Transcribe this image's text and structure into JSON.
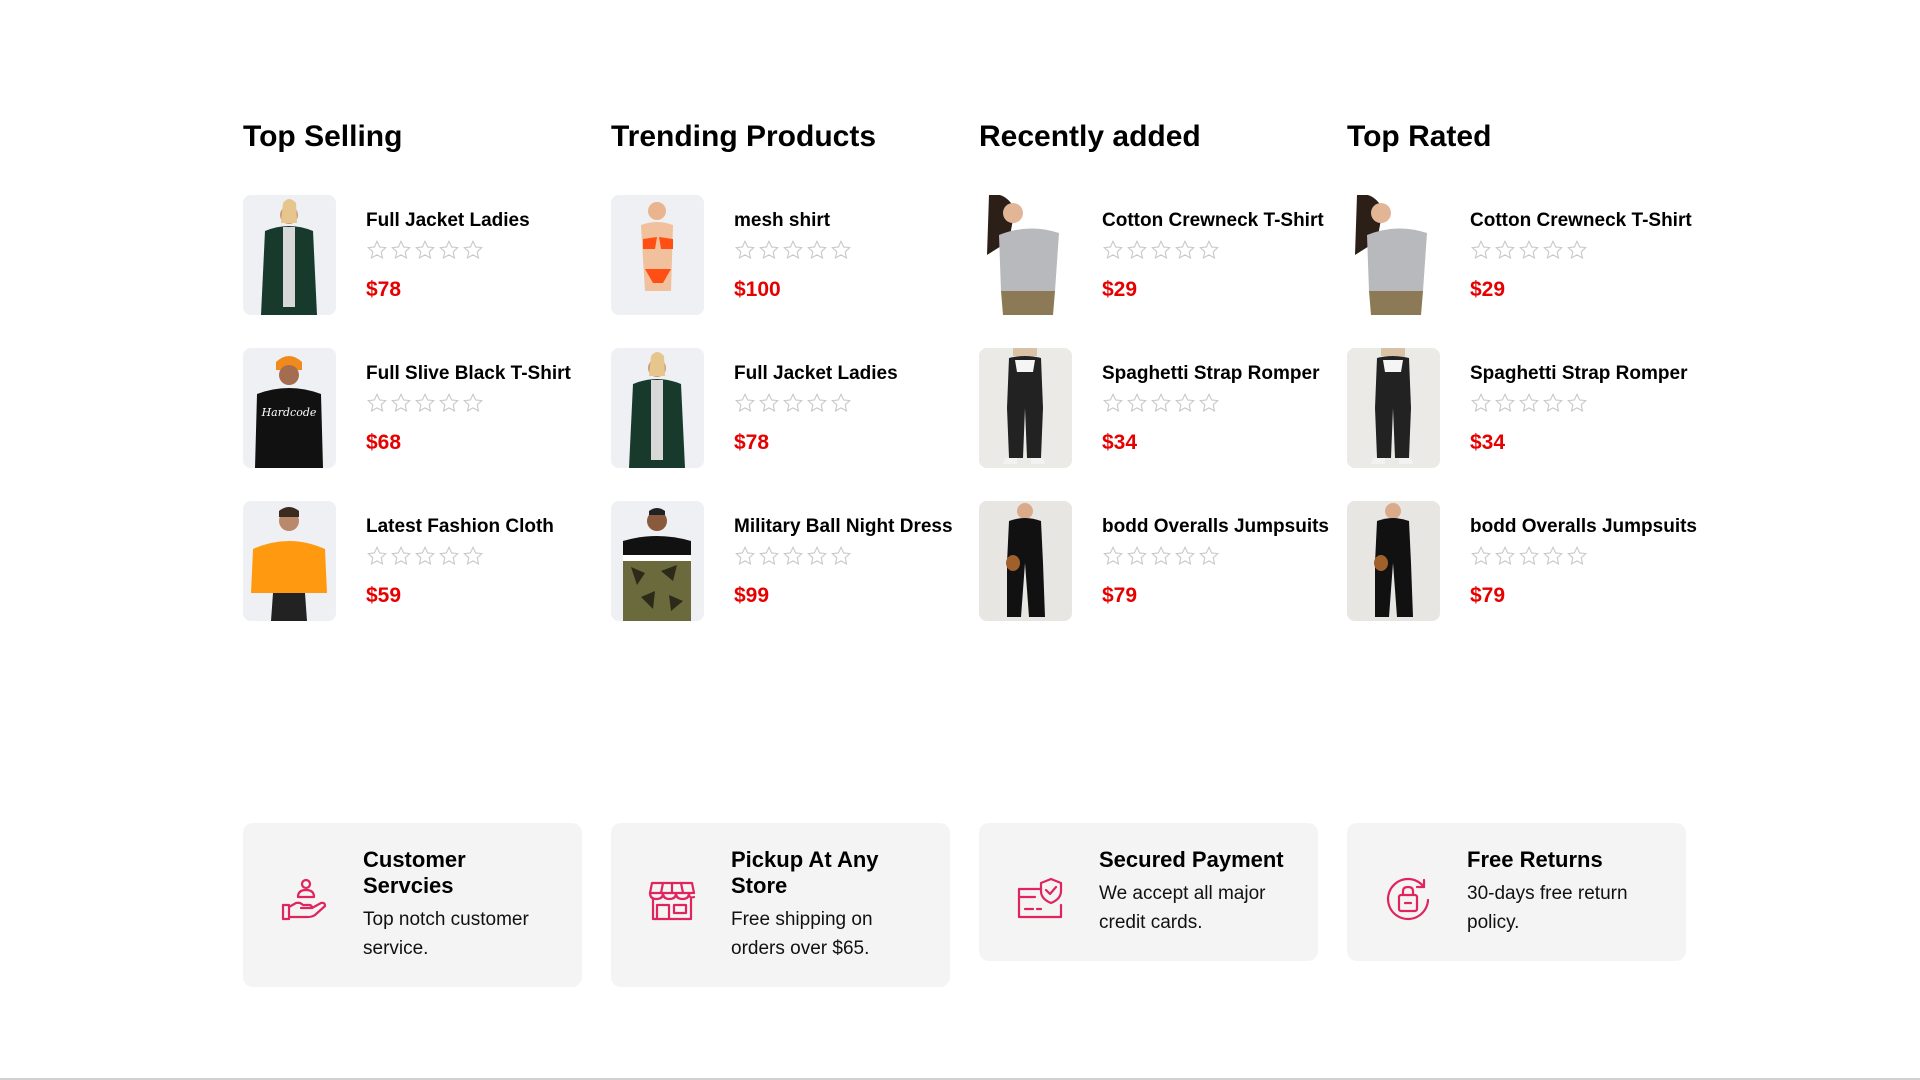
{
  "columns": [
    {
      "title": "Top Selling",
      "items": [
        {
          "name": "Full Jacket Ladies",
          "price": "$78"
        },
        {
          "name": "Full Slive Black T-Shirt",
          "price": "$68"
        },
        {
          "name": "Latest Fashion Cloth",
          "price": "$59"
        }
      ]
    },
    {
      "title": "Trending Products",
      "items": [
        {
          "name": "mesh shirt",
          "price": "$100"
        },
        {
          "name": "Full Jacket Ladies",
          "price": "$78"
        },
        {
          "name": "Military Ball Night Dress",
          "price": "$99"
        }
      ]
    },
    {
      "title": "Recently added",
      "items": [
        {
          "name": "Cotton Crewneck T-Shirt",
          "price": "$29"
        },
        {
          "name": "Spaghetti Strap Romper",
          "price": "$34"
        },
        {
          "name": "bodd Overalls Jumpsuits",
          "price": "$79"
        }
      ]
    },
    {
      "title": "Top Rated",
      "items": [
        {
          "name": "Cotton Crewneck T-Shirt",
          "price": "$29"
        },
        {
          "name": "Spaghetti Strap Romper",
          "price": "$34"
        },
        {
          "name": "bodd Overalls Jumpsuits",
          "price": "$79"
        }
      ]
    }
  ],
  "features": [
    {
      "icon": "hand-user-icon",
      "title": "Customer Servcies",
      "desc": "Top notch customer service."
    },
    {
      "icon": "store-icon",
      "title": "Pickup At Any Store",
      "desc": "Free shipping on orders over $65."
    },
    {
      "icon": "secure-card-icon",
      "title": "Secured Payment",
      "desc": "We accept all major credit cards."
    },
    {
      "icon": "return-bag-icon",
      "title": "Free Returns",
      "desc": "30-days free return policy."
    }
  ],
  "colors": {
    "price": "#e60000",
    "icon_accent": "#e0245e",
    "star_outline": "#c8c8c8",
    "card_bg": "#f4f4f5"
  }
}
